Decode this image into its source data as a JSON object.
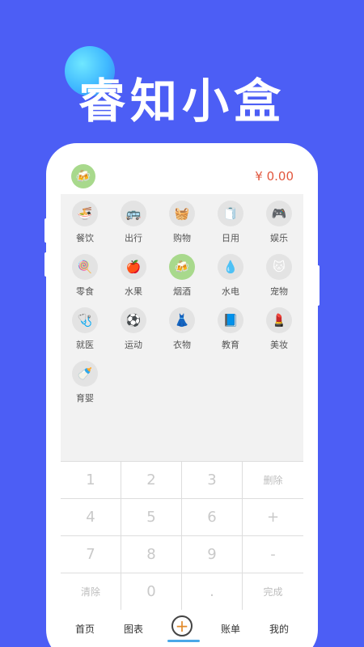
{
  "promo": {
    "title": "睿知小盒"
  },
  "header": {
    "selected_icon": "🍻",
    "amount": "¥ 0.00"
  },
  "categories": [
    {
      "label": "餐饮",
      "icon": "🍜",
      "icon_name": "food-icon"
    },
    {
      "label": "出行",
      "icon": "🚌",
      "icon_name": "bus-icon"
    },
    {
      "label": "购物",
      "icon": "🧺",
      "icon_name": "basket-icon"
    },
    {
      "label": "日用",
      "icon": "🧻",
      "icon_name": "tissue-icon"
    },
    {
      "label": "娱乐",
      "icon": "🎮",
      "icon_name": "gamepad-icon"
    },
    {
      "label": "零食",
      "icon": "🍭",
      "icon_name": "lollipop-icon"
    },
    {
      "label": "水果",
      "icon": "🍎",
      "icon_name": "apple-icon"
    },
    {
      "label": "烟酒",
      "icon": "🍻",
      "icon_name": "beer-icon",
      "active": true
    },
    {
      "label": "水电",
      "icon": "💧",
      "icon_name": "water-drop-icon"
    },
    {
      "label": "宠物",
      "icon": "🐱",
      "icon_name": "pet-icon"
    },
    {
      "label": "就医",
      "icon": "🩺",
      "icon_name": "medical-kit-icon"
    },
    {
      "label": "运动",
      "icon": "⚽",
      "icon_name": "ball-icon"
    },
    {
      "label": "衣物",
      "icon": "👗",
      "icon_name": "dress-icon"
    },
    {
      "label": "教育",
      "icon": "📘",
      "icon_name": "education-icon"
    },
    {
      "label": "美妆",
      "icon": "💄",
      "icon_name": "cosmetics-icon"
    },
    {
      "label": "育婴",
      "icon": "🍼",
      "icon_name": "baby-bottle-icon"
    }
  ],
  "keypad": {
    "keys": [
      "1",
      "2",
      "3",
      "删除",
      "4",
      "5",
      "6",
      "+",
      "7",
      "8",
      "9",
      "-",
      "清除",
      "0",
      ".",
      "完成"
    ]
  },
  "nav": {
    "home": "首页",
    "charts": "图表",
    "add": "+",
    "bills": "账单",
    "mine": "我的"
  },
  "colors": {
    "background": "#4C5EF5",
    "accent_green": "#a8d98c",
    "amount_red": "#e2573e",
    "add_orange": "#e28a2a",
    "underline_blue": "#4aa8e8"
  }
}
